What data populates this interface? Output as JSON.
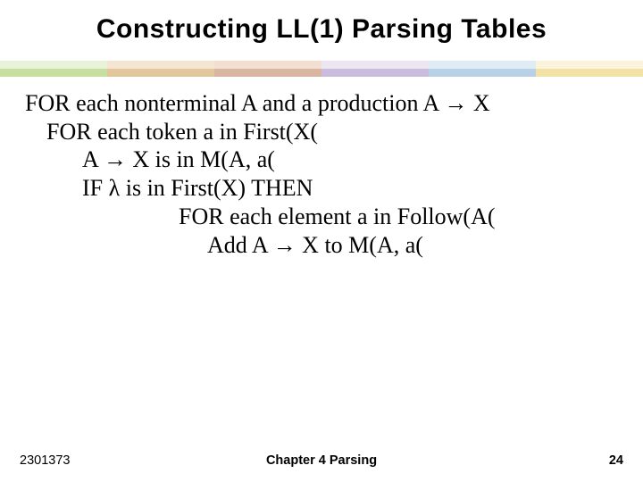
{
  "title": "Constructing LL(1) Parsing Tables",
  "lines": {
    "l1": "FOR each nonterminal A and a production A → X",
    "l2": "FOR each token a in First(X(",
    "l3": "A → X is in M(A, a(",
    "l4": "IF λ is in First(X) THEN",
    "l5": "FOR each element a in Follow(A(",
    "l6": "Add A → X to M(A, a("
  },
  "footer": {
    "left": "2301373",
    "center": "Chapter 4  Parsing",
    "right": "24"
  }
}
